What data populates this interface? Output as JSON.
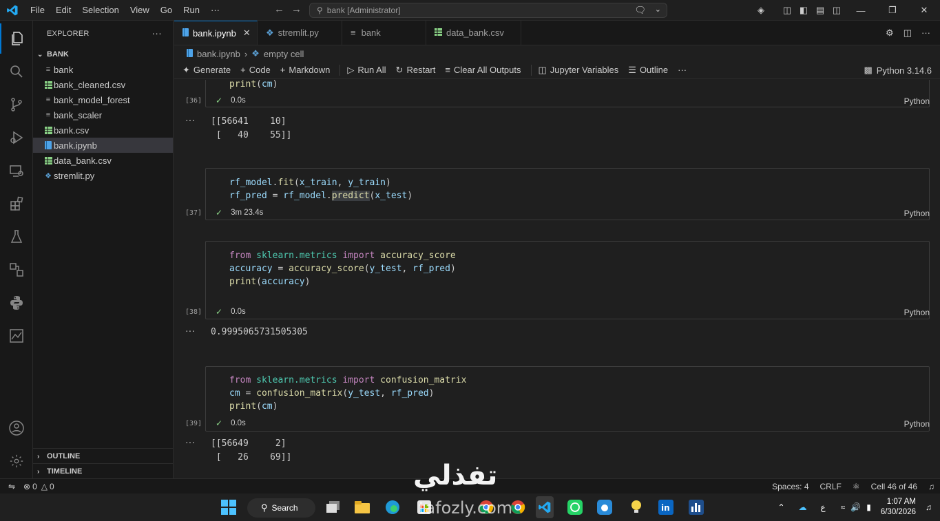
{
  "titlebar": {
    "menu": [
      "File",
      "Edit",
      "Selection",
      "View",
      "Go",
      "Run",
      "···"
    ],
    "search": "bank [Administrator]"
  },
  "sidebar": {
    "header": "EXPLORER",
    "folder": "BANK",
    "files": [
      {
        "name": "bank",
        "icon": "lines-icon"
      },
      {
        "name": "bank_cleaned.csv",
        "icon": "csv-icon"
      },
      {
        "name": "bank_model_forest",
        "icon": "lines-icon"
      },
      {
        "name": "bank_scaler",
        "icon": "lines-icon"
      },
      {
        "name": "bank.csv",
        "icon": "csv-icon"
      },
      {
        "name": "bank.ipynb",
        "icon": "notebook-icon"
      },
      {
        "name": "data_bank.csv",
        "icon": "csv-icon"
      },
      {
        "name": "stremlit.py",
        "icon": "python-icon"
      }
    ],
    "outline": "OUTLINE",
    "timeline": "TIMELINE"
  },
  "tabs": [
    {
      "label": "bank.ipynb",
      "active": true
    },
    {
      "label": "stremlit.py",
      "active": false
    },
    {
      "label": "bank",
      "active": false
    },
    {
      "label": "data_bank.csv",
      "active": false
    }
  ],
  "breadcrumb": {
    "file": "bank.ipynb",
    "cell": "empty cell"
  },
  "toolbar": {
    "generate": "Generate",
    "code": "Code",
    "markdown": "Markdown",
    "run_all": "Run All",
    "restart": "Restart",
    "clear_outputs": "Clear All Outputs",
    "variables": "Jupyter Variables",
    "outline": "Outline",
    "more": "···",
    "kernel": "Python 3.14.6"
  },
  "cells": [
    {
      "count": "[36]",
      "time": "0.0s",
      "lang": "Python",
      "output": "[[56641    10]\n [   40    55]]"
    },
    {
      "count": "[37]",
      "time": "3m 23.4s",
      "lang": "Python"
    },
    {
      "count": "[38]",
      "time": "0.0s",
      "lang": "Python",
      "output": "0.9995065731505305"
    },
    {
      "count": "[39]",
      "time": "0.0s",
      "lang": "Python",
      "output": "[[56649     2]\n [   26    69]]"
    }
  ],
  "statusbar": {
    "errors": "0",
    "warnings": "0",
    "spaces": "Spaces: 4",
    "eol": "CRLF",
    "cell": "Cell 46 of 46"
  },
  "taskbar": {
    "search": "Search",
    "time": "1:07 AM",
    "date": "6/30/2026",
    "lang": "ع"
  },
  "watermark": {
    "arabic": "تفذلي",
    "latin": "tafozly.com"
  }
}
